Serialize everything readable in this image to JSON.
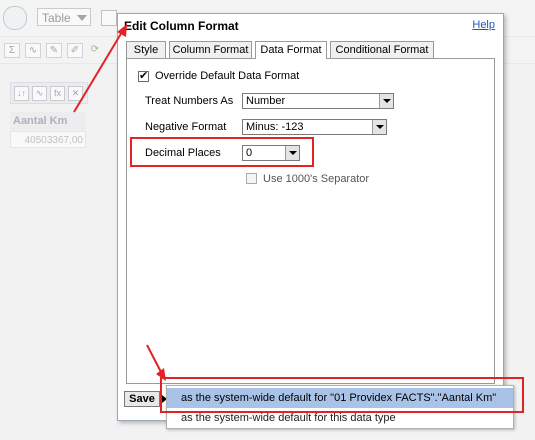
{
  "background": {
    "view_selector_label": "Table",
    "column_header": "Aantal Km",
    "cell_value": "40503367,00",
    "toolbar_icons": [
      "sigma-icon",
      "chart-icon",
      "edit-icon",
      "format-icon",
      "refresh-icon"
    ],
    "column_tool_icons": [
      "sort-icon",
      "chart-icon",
      "formula-icon",
      "delete-icon"
    ]
  },
  "dialog": {
    "title": "Edit Column Format",
    "help_label": "Help",
    "tabs": [
      {
        "label": "Style",
        "active": false
      },
      {
        "label": "Column Format",
        "active": false
      },
      {
        "label": "Data Format",
        "active": true
      },
      {
        "label": "Conditional Format",
        "active": false
      }
    ],
    "override_label": "Override Default Data Format",
    "override_checked": true,
    "treat_numbers_label": "Treat Numbers As",
    "treat_numbers_value": "Number",
    "negative_format_label": "Negative Format",
    "negative_format_value": "Minus: -123",
    "decimal_places_label": "Decimal Places",
    "decimal_places_value": "0",
    "separator_label": "Use 1000's Separator",
    "separator_checked": false,
    "save_label": "Save"
  },
  "save_menu": {
    "items": [
      "as the system-wide default for \"01 Providex FACTS\".\"Aantal Km\"",
      "as the system-wide default for this data type"
    ]
  },
  "annotation_color": "#e32226"
}
